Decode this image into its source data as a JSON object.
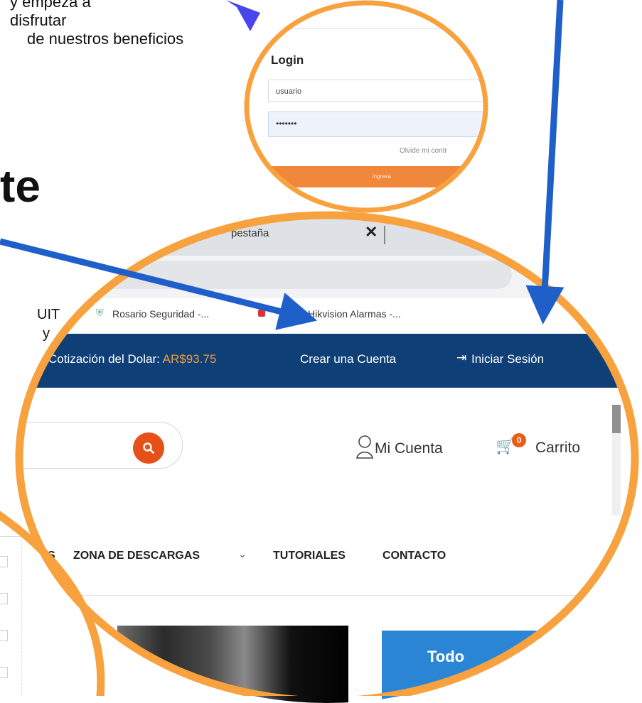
{
  "intro": {
    "line1": "y empezá a",
    "line2": "disfrutar",
    "line3": "de nuestros beneficios"
  },
  "big_heading_fragment": "te",
  "left_fragment": {
    "line1": "UIT",
    "line2": "y"
  },
  "login_panel": {
    "title": "Login",
    "username_value": "usuario",
    "password_value": "•••••••",
    "forgot_link": "Olvide mi contr",
    "submit_label": "ingresa"
  },
  "browser": {
    "tab_title": "pestaña",
    "tab_close": "✕",
    "star": "☆",
    "bookmarks": [
      "Rosario Seguridad -...",
      "Hikvision Alarmas -..."
    ]
  },
  "site": {
    "dolar_label": "Cotización del Dolar:",
    "dolar_value": "AR$93.75",
    "crear_cuenta": "Crear una Cuenta",
    "iniciar_sesion": "Iniciar Sesión",
    "mi_cuenta": "Mi Cuenta",
    "cart_count": "0",
    "carrito": "Carrito",
    "nav": {
      "cut_item": "S",
      "descargas": "ZONA DE DESCARGAS",
      "tutoriales": "TUTORIALES",
      "contacto": "CONTACTO"
    },
    "banner_text": "Todo"
  },
  "colors": {
    "highlight_orange": "#f7a23e",
    "arrow_blue": "#1f5fc9",
    "arrow_purple": "#4a46ee",
    "brand_navy": "#0f3f77",
    "search_orange": "#e6511a"
  }
}
